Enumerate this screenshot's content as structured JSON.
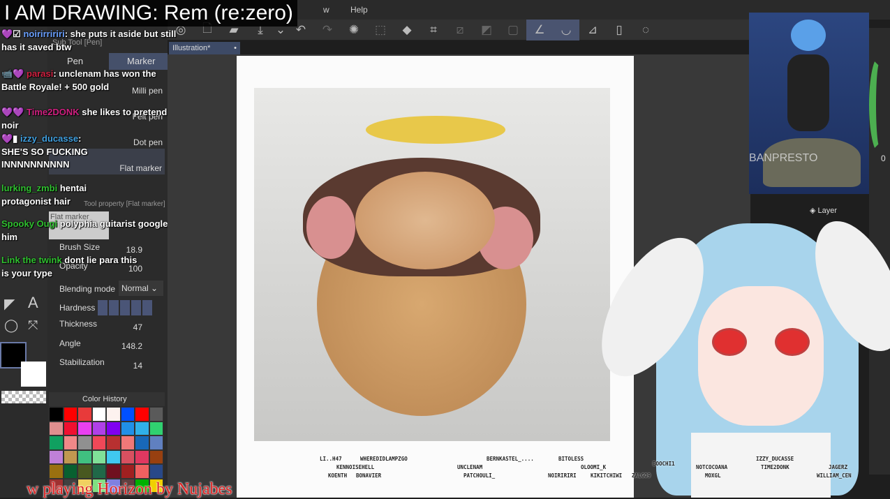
{
  "stream_title": "I AM DRAWING: Rem (re:zero)",
  "menu": {
    "help": "Help",
    "window": "w"
  },
  "document_tab": "Illustration*",
  "subtool": {
    "title": "Sub Tool [Pen]",
    "tabs": [
      "Pen",
      "Marker"
    ],
    "brushes": [
      "Milli pen",
      "Felt pen",
      "Dot pen",
      "Flat marker"
    ]
  },
  "tool_property": {
    "title": "Tool property [Flat marker]",
    "preview": "Flat marker",
    "rows": [
      {
        "label": "Brush Size",
        "value": "18.9"
      },
      {
        "label": "Opacity",
        "value": "100"
      },
      {
        "label": "Blending mode",
        "value": "Normal"
      },
      {
        "label": "Hardness",
        "value": ""
      },
      {
        "label": "Thickness",
        "value": "47"
      },
      {
        "label": "Angle",
        "value": "148.2"
      },
      {
        "label": "Stabilization",
        "value": "14"
      }
    ]
  },
  "color_history": {
    "title": "Color History",
    "colors": [
      "#000000",
      "#ff0000",
      "#e83a3a",
      "#ffffff",
      "#fdf2ef",
      "#0050ff",
      "#ff0000",
      "#5a5a5a",
      "#e08f8f",
      "#f01030",
      "#e840f0",
      "#b040e8",
      "#8000f0",
      "#2090e8",
      "#30b0e8",
      "#30d070",
      "#10a060",
      "#f08888",
      "#909090",
      "#f04858",
      "#b83030",
      "#f07878",
      "#1868b8",
      "#6080c0",
      "#c080d8",
      "#c09850",
      "#40c080",
      "#80e098",
      "#40c8f0",
      "#d85060",
      "#e03860",
      "#984010",
      "#9a7010",
      "#086030",
      "#485820",
      "#206848",
      "#701020",
      "#a02020",
      "#f06060",
      "#284888",
      "#a03030",
      "#404040",
      "#f0d060",
      "#80e080",
      "#8080e0",
      "#604040",
      "#00b000",
      "#f0d000"
    ]
  },
  "layer_panel": {
    "title": "Layer",
    "value": "0"
  },
  "figure_watermark": "BANPRESTO",
  "chat": [
    {
      "user": "noirirririri",
      "sep": ": ",
      "text": "she puts it aside but still has it saved btw"
    },
    {
      "user": "parasi",
      "sep": ": ",
      "text": "unclenam has won the Battle Royale! + 500 gold"
    },
    {
      "user": "Time2DONK",
      "sep": " ",
      "text": "she likes to pretend noir"
    },
    {
      "user": "izzy_ducasse",
      "sep": ": ",
      "text": "SHE'S SO FUCKING INNNNNNNNNN"
    },
    {
      "user": "lurking_zmbi",
      "sep": " ",
      "text": "hentai protagonist hair"
    },
    {
      "user": "Spooky Ougi",
      "sep": " ",
      "text": "polyphia guitarist google him"
    },
    {
      "user": "Link the twink",
      "sep": " ",
      "text": "dont lie para this is your type"
    }
  ],
  "now_playing": "w playing Horizon by Nujabes",
  "viewers": [
    "LI..H47",
    "WHEREDIDLAMPZGO",
    "KENNOISEHELL",
    "KOENTH",
    "BONAVIER",
    "UNCLENAM",
    "PATCHOULI_",
    "BERNKASTEL_....",
    "NOIRIRIRI",
    "BITOLESS",
    "OLOOMI_K",
    "KIKITCHIWI",
    "ZALGO9",
    "BOOCHI1",
    "NOTCOCOANA",
    "MOXGL",
    "IZZY_DUCASSE",
    "TIME2DONK",
    "JAGERZ",
    "WILLIAM_CEN"
  ]
}
